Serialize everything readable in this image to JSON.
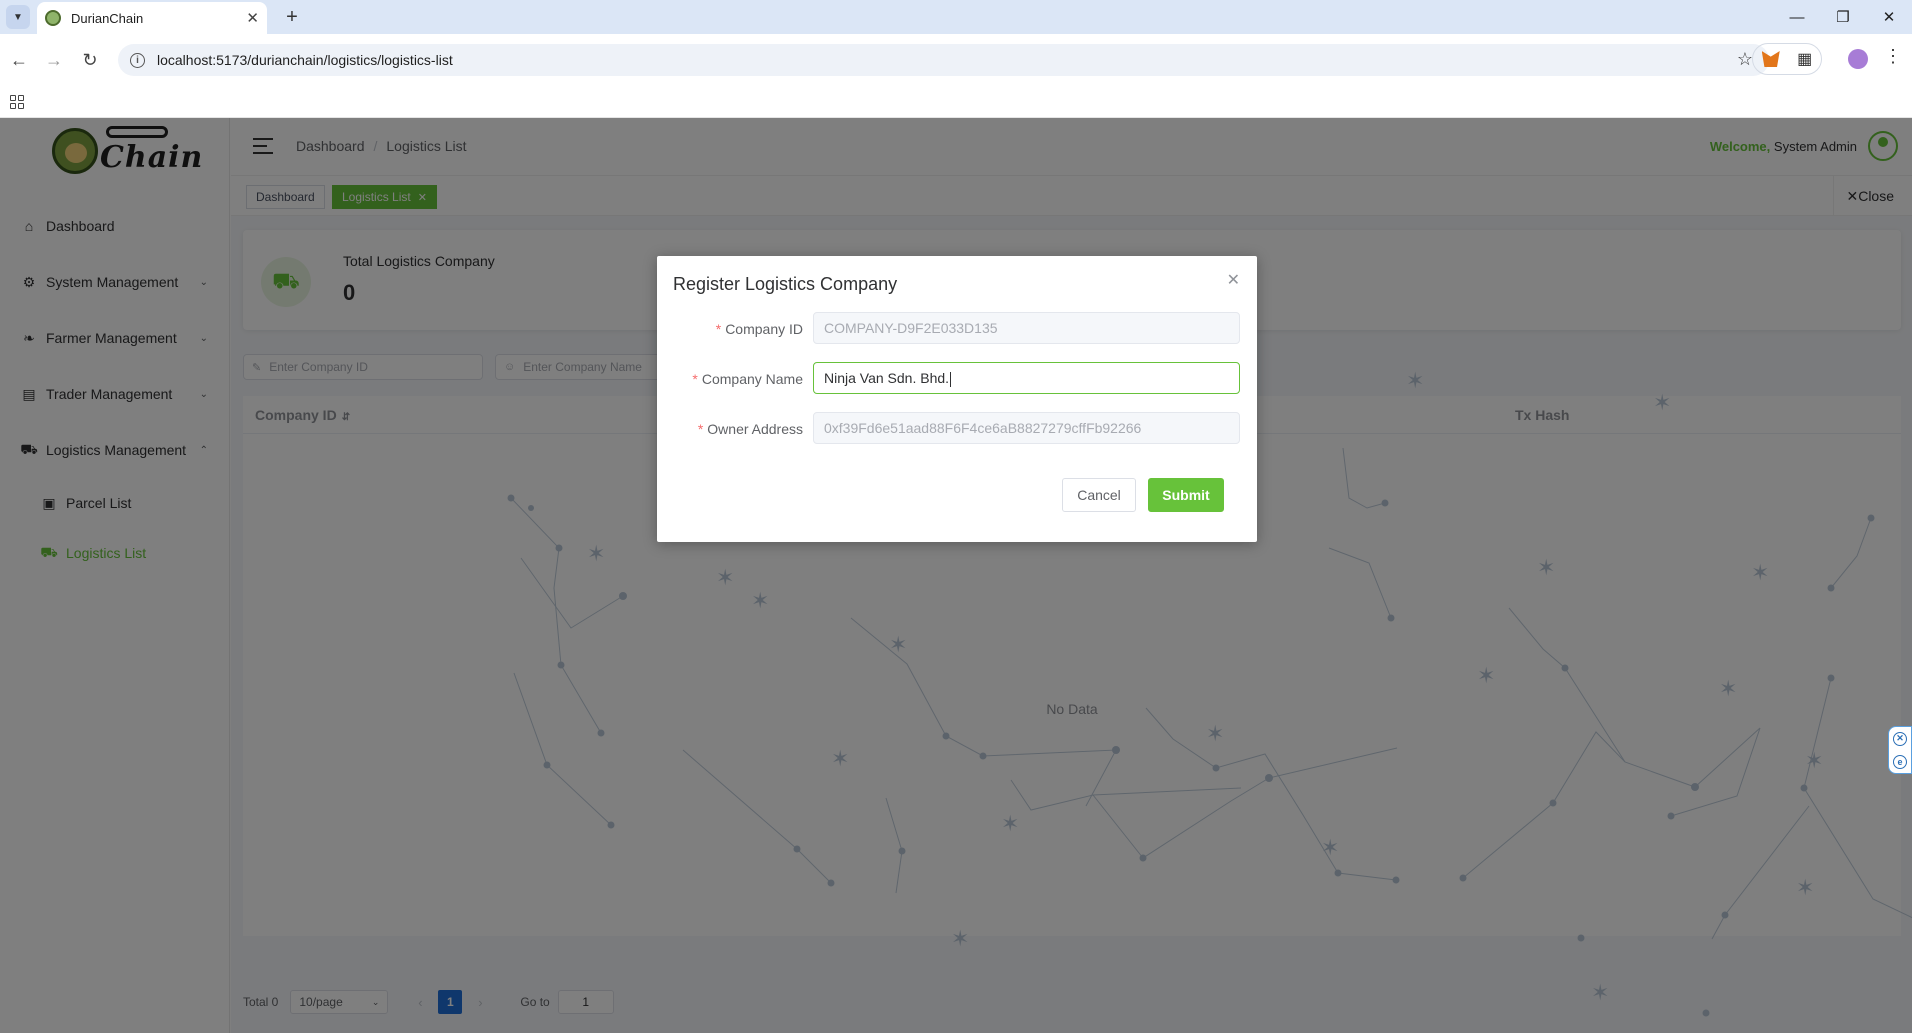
{
  "browser": {
    "tab_title": "DurianChain",
    "url": "localhost:5173/durianchain/logistics/logistics-list"
  },
  "sidebar": {
    "logo_text": "Chain",
    "items": [
      {
        "label": "Dashboard",
        "icon": "home-icon"
      },
      {
        "label": "System Management",
        "icon": "gear-icon"
      },
      {
        "label": "Farmer Management",
        "icon": "leaf-icon"
      },
      {
        "label": "Trader Management",
        "icon": "wallet-icon"
      },
      {
        "label": "Logistics Management",
        "icon": "truck-icon"
      }
    ],
    "subitems": [
      {
        "label": "Parcel List",
        "icon": "parcel-icon"
      },
      {
        "label": "Logistics List",
        "icon": "truck-icon",
        "active": true
      }
    ]
  },
  "header": {
    "breadcrumb": [
      "Dashboard",
      "Logistics List"
    ],
    "breadcrumb_sep": "/",
    "welcome": "Welcome,",
    "user": "System Admin"
  },
  "tags": {
    "items": [
      "Dashboard",
      "Logistics List"
    ],
    "close_label": "Close"
  },
  "stat": {
    "label": "Total Logistics Company",
    "value": "0"
  },
  "search": {
    "company_id_placeholder": "Enter Company ID",
    "company_name_placeholder": "Enter Company Name"
  },
  "table": {
    "columns": [
      "Company ID",
      "Tx Hash"
    ],
    "empty_text": "No Data"
  },
  "pagination": {
    "total": "Total 0",
    "page_size": "10/page",
    "current_page": "1",
    "goto_label": "Go to",
    "goto_value": "1"
  },
  "dialog": {
    "title": "Register Logistics Company",
    "fields": [
      {
        "label": "Company ID",
        "value": "COMPANY-D9F2E033D135"
      },
      {
        "label": "Company Name",
        "value": "Ninja Van Sdn. Bhd."
      },
      {
        "label": "Owner Address",
        "value": "0xf39Fd6e51aad88F6F4ce6aB8827279cffFb92266"
      }
    ],
    "required_mark": "*",
    "cancel": "Cancel",
    "submit": "Submit"
  },
  "colors": {
    "accent": "#67c23a",
    "required": "#f56c6c",
    "pager": "#1e6fd9"
  }
}
